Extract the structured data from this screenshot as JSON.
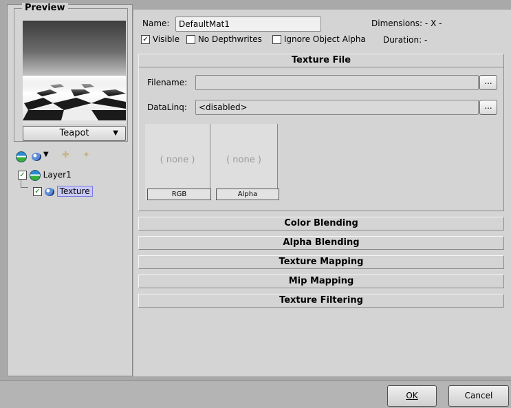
{
  "preview": {
    "title": "Preview",
    "model_select": "Teapot"
  },
  "tree": {
    "layer": {
      "label": "Layer1",
      "checked": true
    },
    "texture": {
      "label": "Texture",
      "checked": true
    }
  },
  "material": {
    "name_label": "Name:",
    "name_value": "DefaultMat1",
    "dimensions_label": "Dimensions:",
    "dimensions_value": "- X -",
    "duration_label": "Duration:",
    "duration_value": "-",
    "visible_label": "Visible",
    "visible_checked": true,
    "no_depthwrites_label": "No Depthwrites",
    "ignore_alpha_label": "Ignore Object Alpha"
  },
  "texture_file": {
    "header": "Texture File",
    "filename_label": "Filename:",
    "filename_value": "",
    "browse_label": "...",
    "datalinq_label": "DataLinq:",
    "datalinq_value": "<disabled>",
    "rgb": {
      "placeholder": "( none )",
      "button": "RGB"
    },
    "alpha": {
      "placeholder": "( none )",
      "button": "Alpha"
    }
  },
  "sections": [
    "Color Blending",
    "Alpha Blending",
    "Texture Mapping",
    "Mip Mapping",
    "Texture Filtering"
  ],
  "buttons": {
    "ok": "OK",
    "cancel": "Cancel"
  },
  "colors": {
    "selection": "#c9c9f5",
    "panel": "#d4d4d4",
    "background": "#a9a9a9"
  }
}
